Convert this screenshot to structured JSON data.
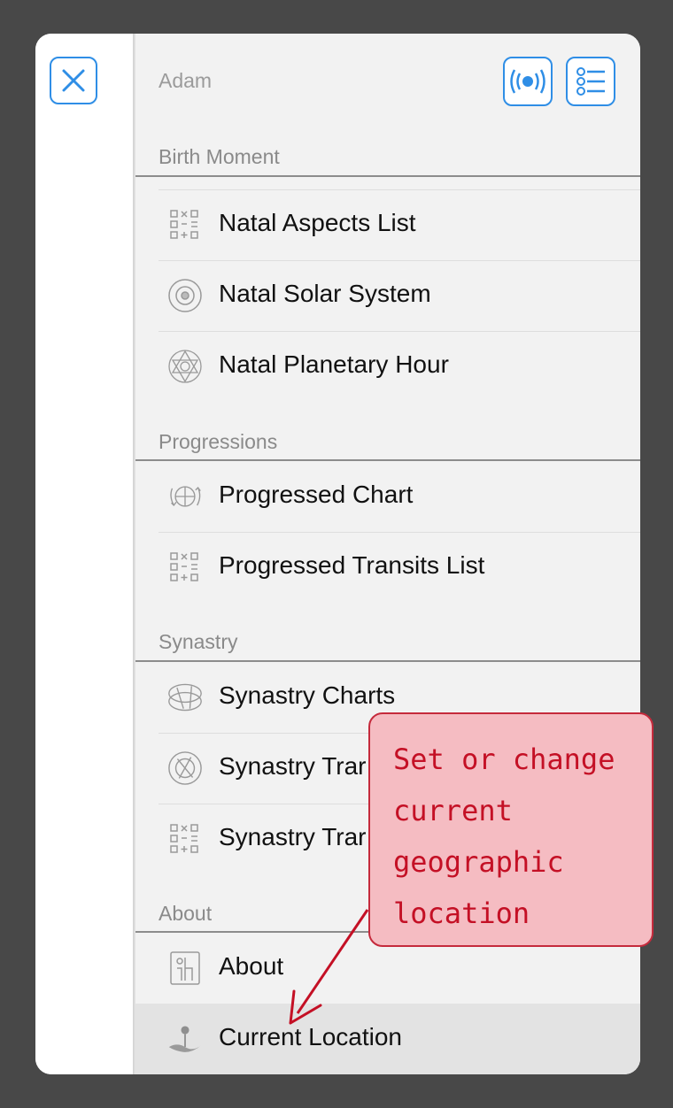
{
  "header": {
    "user_name": "Adam"
  },
  "sections": {
    "birth": {
      "title": "Birth Moment",
      "items": [
        {
          "label": "Natal Aspects List",
          "icon": "aspects-grid-icon"
        },
        {
          "label": "Natal Solar System",
          "icon": "solar-system-icon"
        },
        {
          "label": "Natal Planetary Hour",
          "icon": "planetary-hour-icon"
        }
      ]
    },
    "progressions": {
      "title": "Progressions",
      "items": [
        {
          "label": "Progressed Chart",
          "icon": "progressed-chart-icon"
        },
        {
          "label": "Progressed Transits List",
          "icon": "aspects-grid-icon"
        }
      ]
    },
    "synastry": {
      "title": "Synastry",
      "items": [
        {
          "label": "Synastry Charts",
          "icon": "synastry-charts-icon"
        },
        {
          "label": "Synastry Trar",
          "icon": "synastry-transits-icon"
        },
        {
          "label": "Synastry Trar",
          "icon": "aspects-grid-icon"
        }
      ]
    },
    "about": {
      "title": "About",
      "items": [
        {
          "label": "About",
          "icon": "info-icon"
        },
        {
          "label": "Current Location",
          "icon": "location-pin-icon"
        }
      ]
    }
  },
  "callout": {
    "lines": [
      "Set or change",
      "current",
      "geographic",
      "location"
    ]
  },
  "colors": {
    "accent": "#2f8ee6",
    "callout_text": "#c41025",
    "callout_bg": "#f5bcc2"
  }
}
